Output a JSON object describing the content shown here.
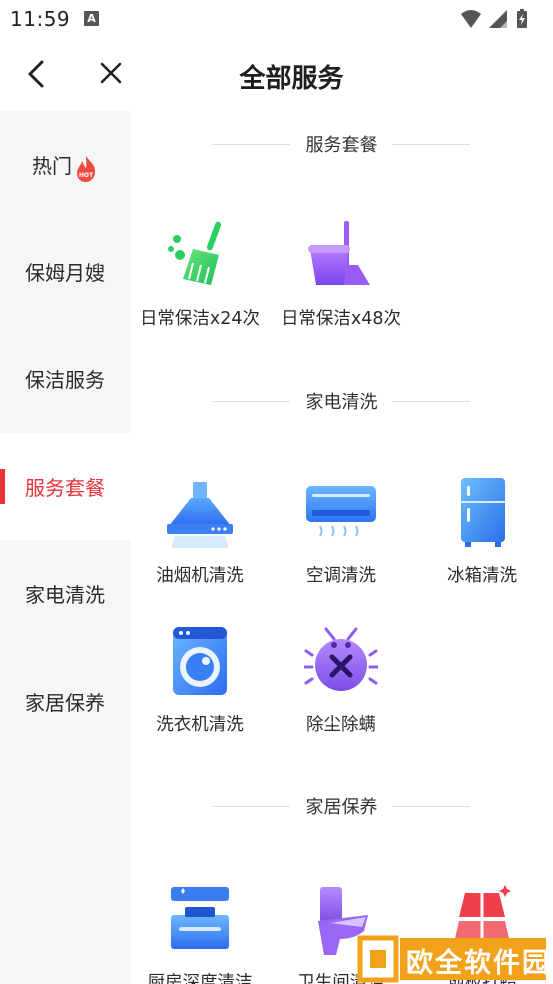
{
  "status_bar": {
    "time": "11:59",
    "notification_glyph": "A"
  },
  "header": {
    "title": "全部服务"
  },
  "sidebar": {
    "items": [
      {
        "label": "热门",
        "badge": "HOT"
      },
      {
        "label": "保姆月嫂"
      },
      {
        "label": "保洁服务"
      },
      {
        "label": "服务套餐",
        "active": true
      },
      {
        "label": "家电清洗"
      },
      {
        "label": "家居保养"
      }
    ]
  },
  "sections": [
    {
      "title": "服务套餐",
      "items": [
        {
          "label": "日常保洁x24次",
          "icon": "broom-icon"
        },
        {
          "label": "日常保洁x48次",
          "icon": "bucket-mop-icon"
        }
      ]
    },
    {
      "title": "家电清洗",
      "items": [
        {
          "label": "油烟机清洗",
          "icon": "range-hood-icon"
        },
        {
          "label": "空调清洗",
          "icon": "air-conditioner-icon"
        },
        {
          "label": "冰箱清洗",
          "icon": "fridge-icon"
        },
        {
          "label": "洗衣机清洗",
          "icon": "washing-machine-icon"
        },
        {
          "label": "除尘除螨",
          "icon": "mite-icon"
        }
      ]
    },
    {
      "title": "家居保养",
      "items": [
        {
          "label": "厨房深度清洁",
          "icon": "kitchen-icon"
        },
        {
          "label": "卫生间清洁",
          "icon": "toilet-icon"
        },
        {
          "label": "地板打蜡",
          "icon": "floor-wax-icon"
        }
      ]
    }
  ],
  "watermark": {
    "text": "欧全软件园"
  },
  "colors": {
    "accent": "#e8343a",
    "sidebar_bg": "#f5f6f6"
  }
}
